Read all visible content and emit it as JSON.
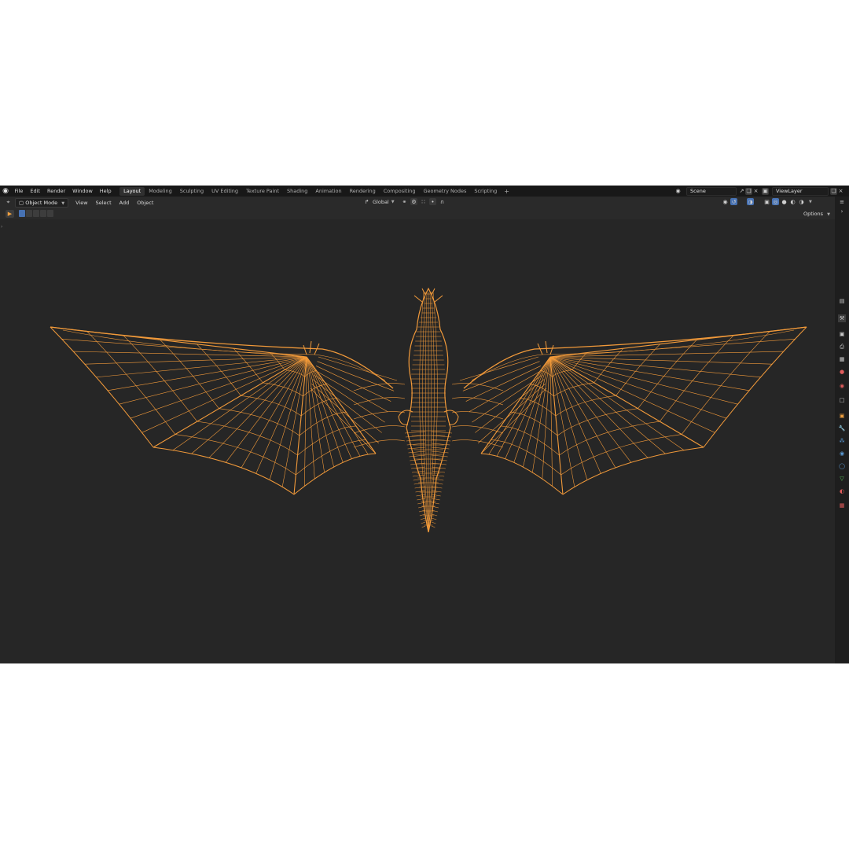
{
  "topbar": {
    "menus": [
      "File",
      "Edit",
      "Render",
      "Window",
      "Help"
    ],
    "workspaces": [
      "Layout",
      "Modeling",
      "Sculpting",
      "UV Editing",
      "Texture Paint",
      "Shading",
      "Animation",
      "Rendering",
      "Compositing",
      "Geometry Nodes",
      "Scripting"
    ],
    "active_workspace": "Layout",
    "add_workspace": "+",
    "scene": "Scene",
    "view_layer": "ViewLayer"
  },
  "header": {
    "mode": "Object Mode",
    "menus": [
      "View",
      "Select",
      "Add",
      "Object"
    ],
    "transform_orientation": "Global"
  },
  "toolrow": {
    "options_label": "Options"
  },
  "colors": {
    "wire": "#f29a3a",
    "viewport_bg": "#262626",
    "active_tab": "#303030",
    "accent_blue": "#4772b3"
  },
  "viewport": {
    "object": "dragon-wireframe",
    "shading": "wireframe"
  }
}
